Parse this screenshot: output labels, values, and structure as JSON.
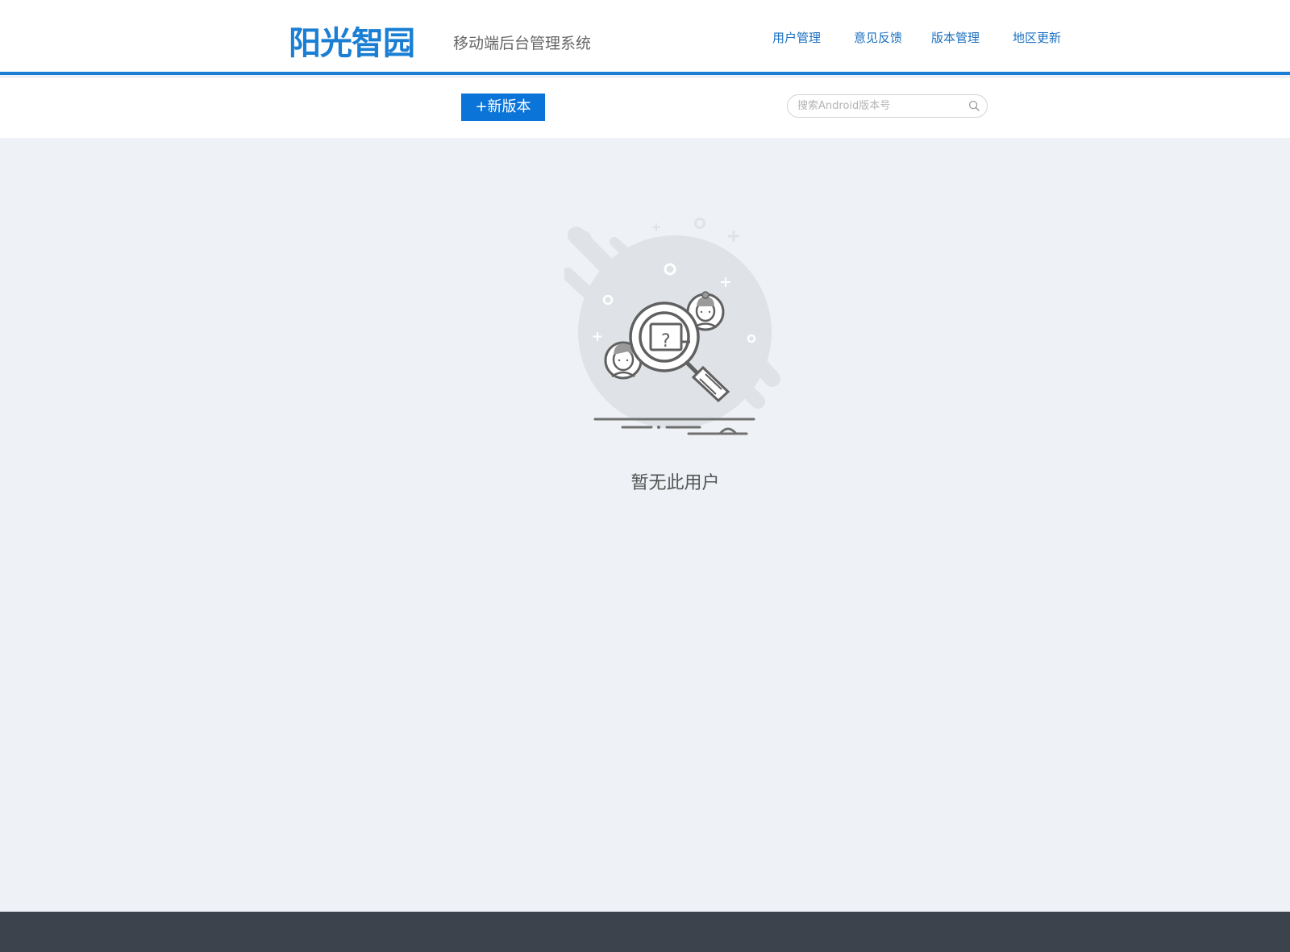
{
  "header": {
    "logo_text": "阳光智园",
    "subtitle": "移动端后台管理系统",
    "nav": [
      {
        "label": "用户管理"
      },
      {
        "label": "意见反馈"
      },
      {
        "label": "版本管理"
      },
      {
        "label": "地区更新"
      }
    ]
  },
  "toolbar": {
    "new_version_label": "+新版本",
    "search": {
      "placeholder": "搜索Android版本号",
      "value": "",
      "icon": "search-icon"
    }
  },
  "empty_state": {
    "message": "暂无此用户",
    "illustration": "magnifier-people-illustration"
  },
  "colors": {
    "brand": "#1a7fd4",
    "button": "#0a74d8",
    "nav_text": "#1a6fc0",
    "background": "#eef1f5",
    "footer": "#3c434d"
  }
}
